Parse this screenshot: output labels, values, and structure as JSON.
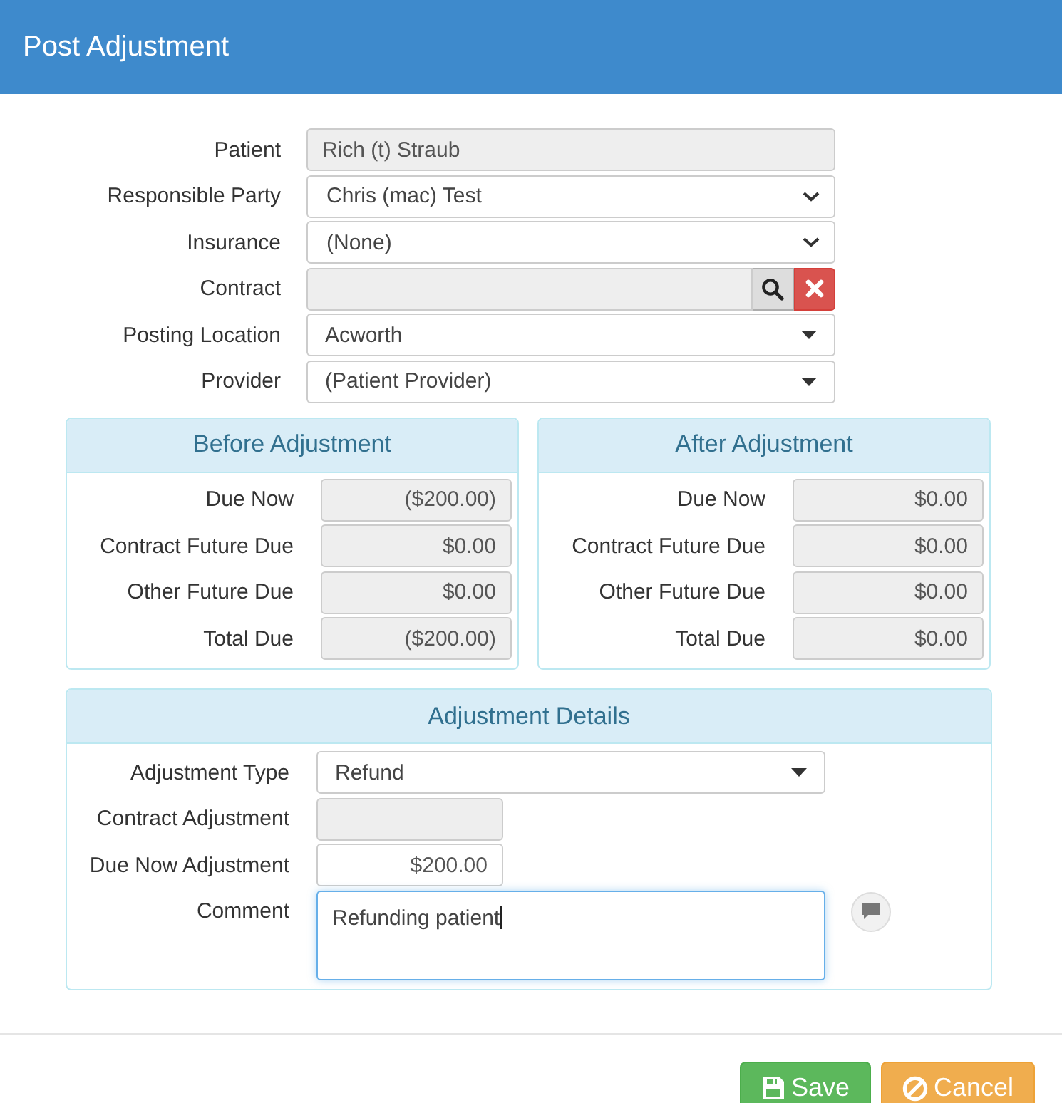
{
  "dialog": {
    "title": "Post Adjustment"
  },
  "fields": [
    {
      "label": "Patient",
      "kind": "readonly",
      "value": "Rich (t) Straub"
    },
    {
      "label": "Responsible Party",
      "kind": "select",
      "value": "Chris (mac) Test"
    },
    {
      "label": "Insurance",
      "kind": "select",
      "value": "(None)"
    },
    {
      "label": "Contract",
      "kind": "lookup"
    },
    {
      "label": "Posting Location",
      "kind": "dropdown",
      "value": "Acworth"
    },
    {
      "label": "Provider",
      "kind": "dropdown",
      "value": "(Patient Provider)"
    }
  ],
  "summaries": [
    {
      "title": "Before Adjustment",
      "rows": [
        {
          "label": "Due Now",
          "value": "($200.00)"
        },
        {
          "label": "Contract Future Due",
          "value": "$0.00"
        },
        {
          "label": "Other Future Due",
          "value": "$0.00"
        },
        {
          "label": "Total Due",
          "value": "($200.00)"
        }
      ]
    },
    {
      "title": "After Adjustment",
      "rows": [
        {
          "label": "Due Now",
          "value": "$0.00"
        },
        {
          "label": "Contract Future Due",
          "value": "$0.00"
        },
        {
          "label": "Other Future Due",
          "value": "$0.00"
        },
        {
          "label": "Total Due",
          "value": "$0.00"
        }
      ]
    }
  ],
  "details": {
    "title": "Adjustment Details",
    "fields": [
      {
        "label": "Adjustment Type",
        "kind": "dropdown",
        "value": "Refund"
      },
      {
        "label": "Contract Adjustment",
        "kind": "readonly_short"
      },
      {
        "label": "Due Now Adjustment",
        "kind": "amount",
        "value": "$200.00"
      },
      {
        "label": "Comment",
        "kind": "comment",
        "value": "Refunding patient"
      }
    ]
  },
  "buttons": [
    {
      "label": "Save",
      "kind": "save"
    },
    {
      "label": "Cancel",
      "kind": "cancel"
    }
  ]
}
